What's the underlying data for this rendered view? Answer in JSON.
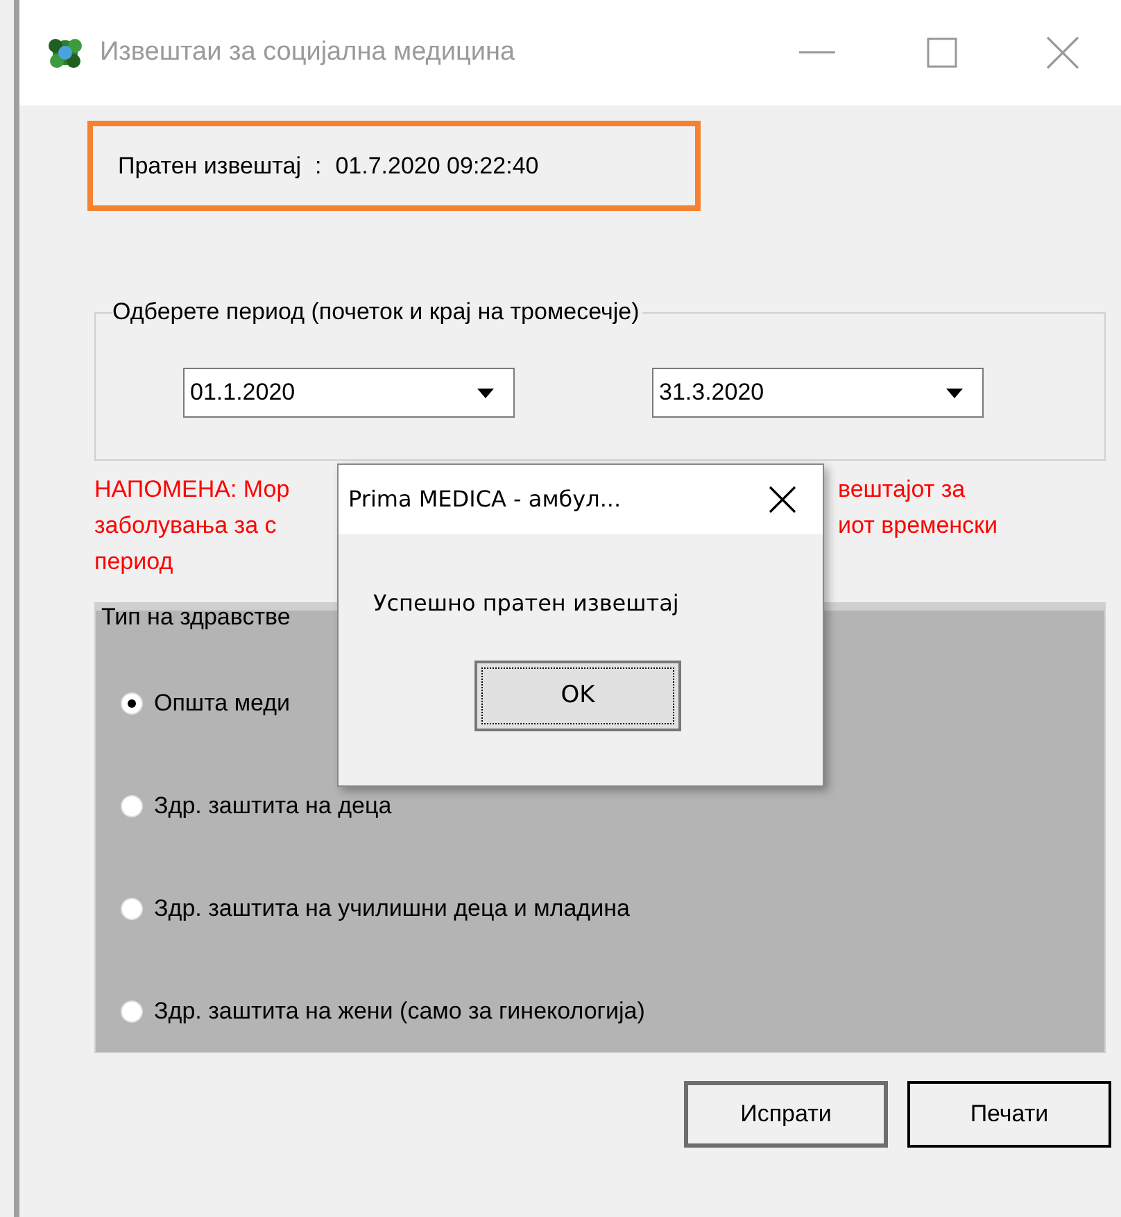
{
  "window": {
    "title": "Извештаи за социјална медицина"
  },
  "sent_report": {
    "label": "Пратен извештај",
    "separator": ":",
    "value": "01.7.2020 09:22:40"
  },
  "period": {
    "legend": "Одберете период (почеток и крај на тромесечје)",
    "from": "01.1.2020",
    "to": "31.3.2020"
  },
  "note": {
    "lines": [
      {
        "left": "НАПОМЕНА: Мор",
        "right": "вештајот за"
      },
      {
        "left": "заболувања за с",
        "right": "иот временски"
      },
      {
        "left": "период"
      }
    ]
  },
  "care_type": {
    "legend": "Тип на здравстве",
    "options": [
      {
        "label": "Општа меди",
        "selected": true
      },
      {
        "label": "Здр. заштита на деца",
        "selected": false
      },
      {
        "label": "Здр. заштита на училишни деца и младина",
        "selected": false
      },
      {
        "label": "Здр. заштита на жени (само за гинекологија)",
        "selected": false
      }
    ]
  },
  "buttons": [
    {
      "label": "Испрати",
      "focused": true
    },
    {
      "label": "Печати",
      "focused": false
    }
  ],
  "dialog": {
    "title": "Prima MEDICA - амбул...",
    "message": "Успешно пратен извештај",
    "button": "OK"
  }
}
